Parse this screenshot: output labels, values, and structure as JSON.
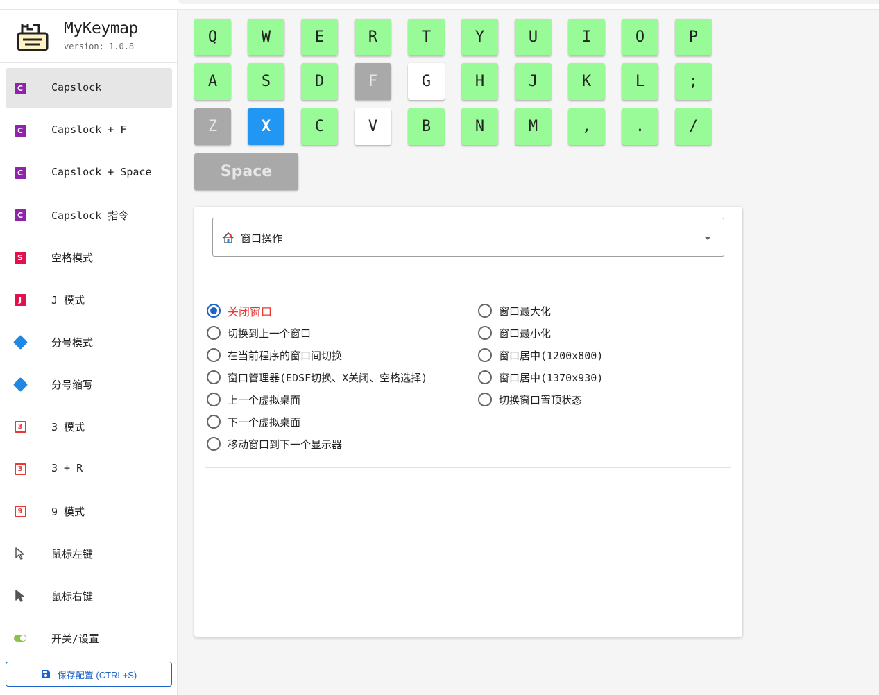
{
  "app": {
    "title": "MyKeymap",
    "version": "version: 1.0.8"
  },
  "sidebar": {
    "items": [
      {
        "label": "Capslock",
        "icon": "c-badge-icon",
        "badge": "C"
      },
      {
        "label": "Capslock + F",
        "icon": "c-badge-icon",
        "badge": "C"
      },
      {
        "label": "Capslock + Space",
        "icon": "c-badge-icon",
        "badge": "C"
      },
      {
        "label": "Capslock 指令",
        "icon": "c-badge-icon",
        "badge": "C"
      },
      {
        "label": "空格模式",
        "icon": "s-badge-icon",
        "badge": "S"
      },
      {
        "label": "J 模式",
        "icon": "j-badge-icon",
        "badge": "J"
      },
      {
        "label": "分号模式",
        "icon": "diamond-icon"
      },
      {
        "label": "分号缩写",
        "icon": "diamond-icon"
      },
      {
        "label": "3 模式",
        "icon": "three-box-icon",
        "badge": "3"
      },
      {
        "label": "3 + R",
        "icon": "three-box-icon",
        "badge": "3"
      },
      {
        "label": "9 模式",
        "icon": "nine-box-icon",
        "badge": "9"
      },
      {
        "label": "鼠标左键",
        "icon": "cursor-outline-icon"
      },
      {
        "label": "鼠标右键",
        "icon": "cursor-filled-icon"
      },
      {
        "label": "开关/设置",
        "icon": "toggle-icon"
      }
    ],
    "active_index": 0,
    "save_label": "保存配置 (CTRL+S)"
  },
  "keyboard": {
    "row1": [
      "Q",
      "W",
      "E",
      "R",
      "T",
      "Y",
      "U",
      "I",
      "O",
      "P"
    ],
    "row2": [
      "A",
      "S",
      "D",
      "F",
      "G",
      "H",
      "J",
      "K",
      "L",
      ";"
    ],
    "row3": [
      "Z",
      "X",
      "C",
      "V",
      "B",
      "N",
      "M",
      ",",
      ".",
      "/"
    ],
    "space": "Space",
    "states": {
      "F": "gray",
      "G": "white",
      "Z": "gray",
      "X": "selected",
      "V": "white",
      "Space": "gray"
    },
    "colors": {
      "mapped": "#98fb98",
      "unmapped": "#ffffff",
      "disabled": "#a9a9a9",
      "selected": "#2196f3"
    }
  },
  "action_panel": {
    "category": "窗口操作",
    "category_icon": "house-icon",
    "options_left": [
      "关闭窗口",
      "切换到上一个窗口",
      "在当前程序的窗口间切换",
      "窗口管理器(EDSF切换、X关闭、空格选择)",
      "上一个虚拟桌面",
      "下一个虚拟桌面",
      "移动窗口到下一个显示器"
    ],
    "options_right": [
      "窗口最大化",
      "窗口最小化",
      "窗口居中(1200x800)",
      "窗口居中(1370x930)",
      "切换窗口置顶状态"
    ],
    "selected": "关闭窗口"
  }
}
